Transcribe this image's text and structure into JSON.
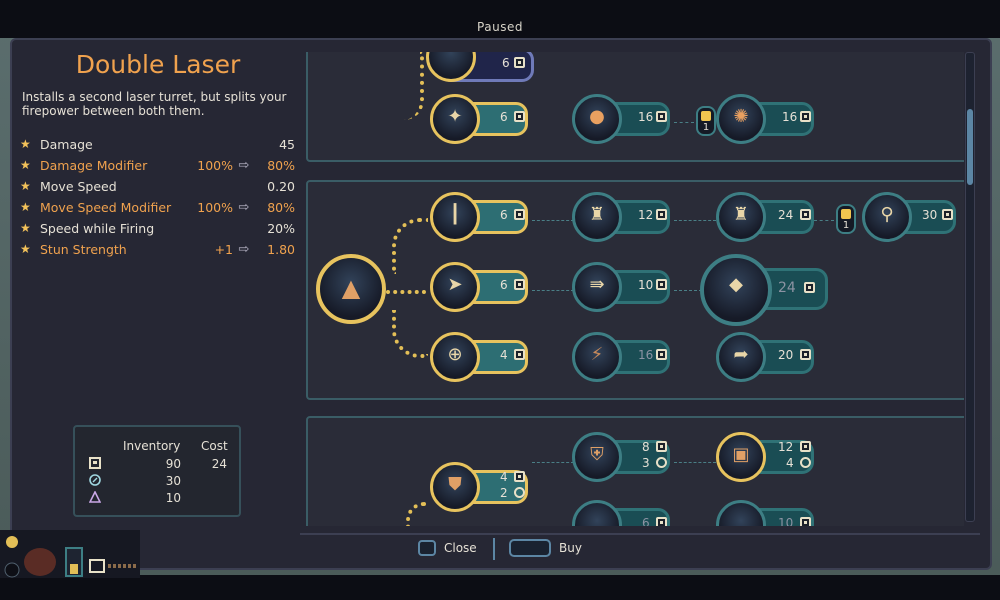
{
  "status": {
    "paused": "Paused"
  },
  "upgrade": {
    "title": "Double Laser",
    "description": "Installs a second laser turret, but splits your firepower between both them."
  },
  "stats": [
    {
      "name": "Damage",
      "from": "",
      "to": "45",
      "modifier": false
    },
    {
      "name": "Damage Modifier",
      "from": "100%",
      "to": "80%",
      "modifier": true
    },
    {
      "name": "Move Speed",
      "from": "",
      "to": "0.20",
      "modifier": false
    },
    {
      "name": "Move Speed Modifier",
      "from": "100%",
      "to": "80%",
      "modifier": true
    },
    {
      "name": "Speed while Firing",
      "from": "",
      "to": "20%",
      "modifier": false
    },
    {
      "name": "Stun Strength",
      "from": "+1",
      "to": "1.80",
      "modifier": true
    }
  ],
  "inventory": {
    "header_inventory": "Inventory",
    "header_cost": "Cost",
    "rows": [
      {
        "icon": "coin-icon",
        "inventory": "90",
        "cost": "24"
      },
      {
        "icon": "gem-icon",
        "inventory": "30",
        "cost": ""
      },
      {
        "icon": "triangle-icon",
        "inventory": "10",
        "cost": ""
      }
    ]
  },
  "tree": {
    "nodes": {
      "top_a_cost": "6",
      "top_b_cost": "6",
      "top_c_cost": "16",
      "top_d_cost": "16",
      "lock_top": "1",
      "mid_root": "",
      "mid_1_cost": "6",
      "mid_2_cost": "6",
      "mid_3_cost": "4",
      "mid_4_cost": "12",
      "mid_5_cost": "10",
      "mid_6_cost": "16",
      "mid_7_cost": "24",
      "mid_8_cost": "24",
      "mid_9_cost": "20",
      "mid_10_cost": "30",
      "lock_mid": "1",
      "bot_1_cost_a": "4",
      "bot_1_cost_b": "2",
      "bot_2_cost_a": "8",
      "bot_2_cost_b": "3",
      "bot_3_cost_a": "12",
      "bot_3_cost_b": "4",
      "bot_4_cost": "6",
      "bot_5_cost": "10"
    }
  },
  "footer": {
    "close": "Close",
    "buy": "Buy"
  },
  "colors": {
    "accent": "#f0a24e",
    "panel": "#262734",
    "teal": "#2f7276",
    "gold": "#e7c35e"
  }
}
